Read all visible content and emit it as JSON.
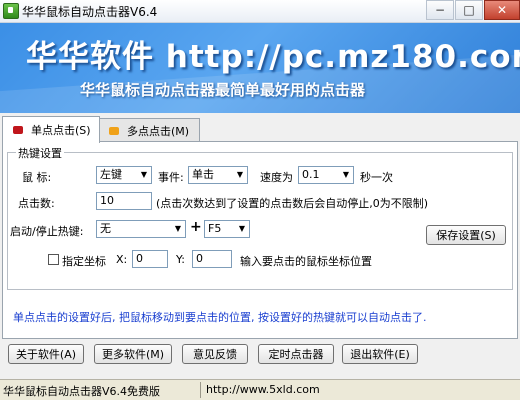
{
  "window": {
    "title": "华华鼠标自动点击器V6.4",
    "minimize_glyph": "−",
    "maximize_glyph": "□",
    "close_glyph": "✕"
  },
  "banner": {
    "title": "华华软件 http://pc.mz180.com",
    "subtitle": "华华鼠标自动点击器最简单最好用的点击器"
  },
  "tabs": [
    {
      "label": "单点点击(S)",
      "icon_color": "#c0161c",
      "active": true
    },
    {
      "label": "多点点击(M)",
      "icon_color": "#f0a21a",
      "active": false
    }
  ],
  "hotkey_group": {
    "title": "热键设置",
    "mouse_label": "鼠  标:",
    "mouse_value": "左键",
    "event_label": "事件:",
    "event_value": "单击",
    "speed_label": "速度为",
    "speed_value": "0.1",
    "speed_unit": "秒一次",
    "count_label": "点击数:",
    "count_value": "10",
    "count_note": "(点击次数达到了设置的点击数后会自动停止,0为不限制)",
    "hotkey_label": "启动/停止热键:",
    "hotkey_mod": "无",
    "plus": "+",
    "hotkey_key": "F5",
    "save_button": "保存设置(S)",
    "fixed_coord_label": "指定坐标",
    "x_label": "X:",
    "x_value": "0",
    "y_label": "Y:",
    "y_value": "0",
    "coord_note": "输入要点击的鼠标坐标位置"
  },
  "hint": "单点点击的设置好后, 把鼠标移动到要点击的位置, 按设置好的热键就可以自动点击了.",
  "bottom_buttons": [
    {
      "label": "关于软件(A)"
    },
    {
      "label": "更多软件(M)"
    },
    {
      "label": "意见反馈"
    },
    {
      "label": "定时点击器"
    },
    {
      "label": "退出软件(E)"
    }
  ],
  "status": {
    "left": "华华鼠标自动点击器V6.4免费版",
    "right": "http://www.5xld.com"
  }
}
